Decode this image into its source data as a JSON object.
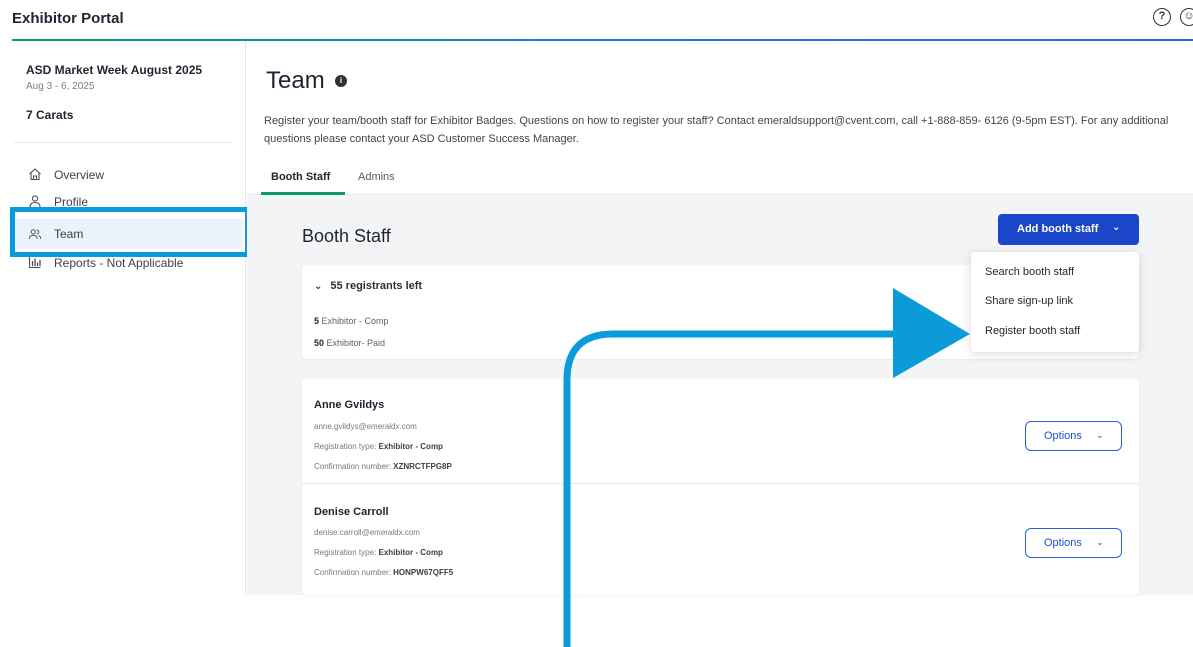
{
  "app": {
    "title": "Exhibitor Portal"
  },
  "colors": {
    "accent_blue": "#1c46c9",
    "highlight": "#0a9bd8",
    "nav_active": "#0c8a6a"
  },
  "icons": {
    "help": "help-circle-icon",
    "user": "user-circle-icon"
  },
  "sidebar": {
    "event_name": "ASD Market Week August 2025",
    "event_dates": "Aug 3 - 6, 2025",
    "company": "7 Carats",
    "items": [
      {
        "label": "Overview",
        "icon": "home-icon"
      },
      {
        "label": "Profile",
        "icon": "person-icon"
      },
      {
        "label": "Team",
        "icon": "team-icon",
        "active": true
      },
      {
        "label": "Reports - Not Applicable",
        "icon": "bar-chart-icon"
      }
    ]
  },
  "main": {
    "title": "Team",
    "description": "Register your team/booth staff for Exhibitor Badges. Questions on how to register your staff? Contact emeraldsupport@cvent.com, call +1-888-859- 6126 (9-5pm EST). For any additional questions please contact your ASD Customer Success Manager.",
    "tabs": [
      {
        "label": "Booth Staff",
        "active": true
      },
      {
        "label": "Admins"
      }
    ],
    "section_title": "Booth Staff",
    "add_button": "Add booth staff",
    "dropdown": [
      "Search booth staff",
      "Share sign-up link",
      "Register booth staff"
    ],
    "registrants": {
      "summary": "55 registrants left",
      "lines": [
        {
          "count": "5",
          "label": "Exhibitor - Comp"
        },
        {
          "count": "50",
          "label": "Exhibitor- Paid"
        }
      ]
    },
    "staff": [
      {
        "name": "Anne Gvildys",
        "email": "anne.gvildys@emeraldx.com",
        "type_label": "Registration type:",
        "type_value": "Exhibitor - Comp",
        "conf_label": "Confirmation number:",
        "conf_value": "XZNRCTFPG8P",
        "options": "Options"
      },
      {
        "name": "Denise Carroll",
        "email": "denise.carroll@emeraldx.com",
        "type_label": "Registration type:",
        "type_value": "Exhibitor - Comp",
        "conf_label": "Confirmation number:",
        "conf_value": "HONPW67QFF5",
        "options": "Options"
      }
    ]
  }
}
